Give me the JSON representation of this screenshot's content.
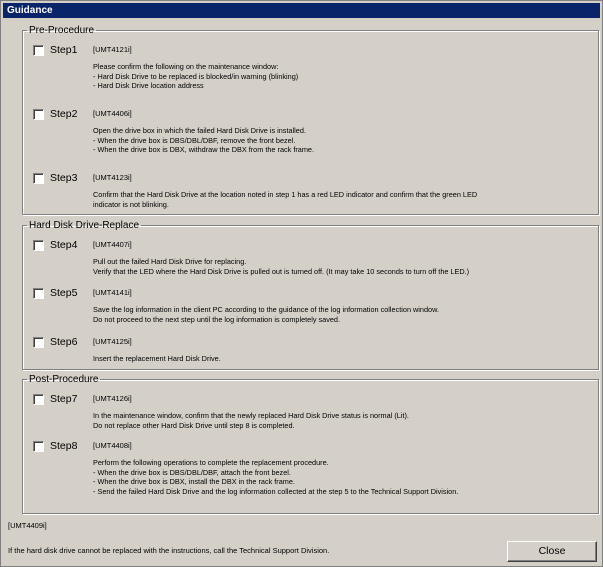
{
  "window": {
    "title": "Guidance"
  },
  "groups": [
    {
      "legend": "Pre-Procedure",
      "steps": [
        {
          "label": "Step1",
          "code": "[UMT4121i]",
          "text": "Please confirm the following on the maintenance window:\n- Hard Disk Drive to be replaced is blocked/in warning (blinking)\n- Hard Disk Drive location address",
          "checked": false
        },
        {
          "label": "Step2",
          "code": "[UMT4406i]",
          "text": "Open the drive box in which the failed Hard Disk Drive is installed.\n- When the drive box is DBS/DBL/DBF, remove the front bezel.\n- When the drive box is DBX, withdraw the DBX from the rack frame.",
          "checked": false
        },
        {
          "label": "Step3",
          "code": "[UMT4123i]",
          "text": "Confirm that the Hard Disk Drive at the location noted in step 1 has a red LED indicator and confirm that the green LED\nindicator is not blinking.",
          "checked": false
        }
      ]
    },
    {
      "legend": "Hard Disk Drive-Replace",
      "steps": [
        {
          "label": "Step4",
          "code": "[UMT4407i]",
          "text": "Pull out the failed Hard Disk Drive for replacing.\nVerify that the LED where the Hard Disk Drive is pulled out is turned off. (It may take 10 seconds to turn off the LED.)",
          "checked": false
        },
        {
          "label": "Step5",
          "code": "[UMT4141i]",
          "text": "Save the log information in the client PC according to the guidance of the log information collection window.\nDo not proceed to the next step until the log information is completely saved.",
          "checked": false
        },
        {
          "label": "Step6",
          "code": "[UMT4125i]",
          "text": "Insert the replacement Hard Disk Drive.",
          "checked": false
        }
      ]
    },
    {
      "legend": "Post-Procedure",
      "steps": [
        {
          "label": "Step7",
          "code": "[UMT4126i]",
          "text": "In the maintenance window, confirm that the newly replaced Hard Disk Drive status is normal (Lit).\nDo not replace other Hard Disk Drive until step 8 is completed.",
          "checked": false
        },
        {
          "label": "Step8",
          "code": "[UMT4408i]",
          "text": "Perform the following operations to complete the replacement procedure.\n- When the drive box is DBS/DBL/DBF, attach the front bezel.\n- When the drive box is DBX, install the DBX in the rack frame.\n- Send the failed Hard Disk Drive and the log information collected at the step 5 to the Technical Support Division.",
          "checked": false
        }
      ]
    }
  ],
  "footer": {
    "code": "[UMT4409i]",
    "text": "If the hard disk drive cannot be replaced with the instructions, call the Technical Support Division.",
    "close_label": "Close"
  }
}
